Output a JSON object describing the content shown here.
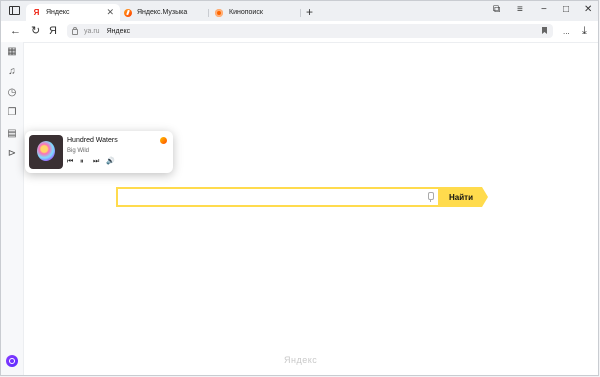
{
  "tabs": [
    {
      "title": "Яндекс",
      "favicon": "Я",
      "active": true
    },
    {
      "title": "Яндекс.Музыка",
      "favicon": "yandex-music-icon",
      "active": false
    },
    {
      "title": "Кинопоиск",
      "favicon": "kinopoisk-icon",
      "active": false
    }
  ],
  "tab_close": "✕",
  "new_tab": "+",
  "address": {
    "domain": "ya.ru",
    "title": "Яндекс"
  },
  "menu_dots": "...",
  "player": {
    "title": "Hundred Waters",
    "artist": "Big Wild"
  },
  "search": {
    "placeholder": "",
    "button": "Найти"
  },
  "footer": {
    "logo": "Яндекс"
  },
  "colors": {
    "accent": "#ffdb4d",
    "alice": "#6a35ff"
  }
}
